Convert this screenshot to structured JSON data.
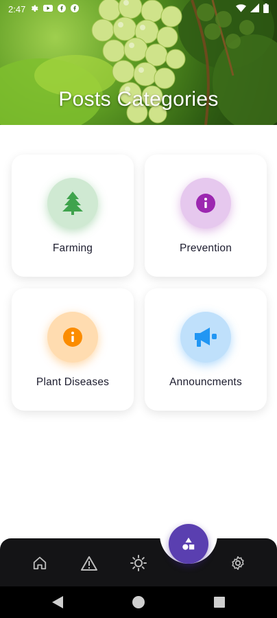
{
  "status_bar": {
    "time": "2:47",
    "icons": [
      "settings-gear-icon",
      "youtube-icon",
      "facebook-icon",
      "facebook-icon"
    ],
    "right_icons": [
      "wifi-icon",
      "signal-icon",
      "battery-icon"
    ]
  },
  "header": {
    "title": "Posts Categories",
    "background": "grape-vine-photo"
  },
  "categories": [
    {
      "label": "Farming",
      "icon": "tree-icon",
      "icon_color": "#3fa34d",
      "bubble_color": "#cfe9d2"
    },
    {
      "label": "Prevention",
      "icon": "info-icon",
      "icon_color": "#9c27b0",
      "bubble_color": "#e6c8ee"
    },
    {
      "label": "Plant Diseases",
      "icon": "info-icon",
      "icon_color": "#fb8c00",
      "bubble_color": "#ffdcb0"
    },
    {
      "label": "Announcments",
      "icon": "megaphone-icon",
      "icon_color": "#2196f3",
      "bubble_color": "#bfe0fb"
    }
  ],
  "bottom_nav": {
    "items": [
      "home-icon",
      "warning-icon",
      "sun-icon",
      "settings-icon"
    ],
    "fab_icon": "shapes-icon",
    "fab_color": "#5a3fb0"
  },
  "system_nav": [
    "back-icon",
    "home-circle-icon",
    "recents-icon"
  ]
}
